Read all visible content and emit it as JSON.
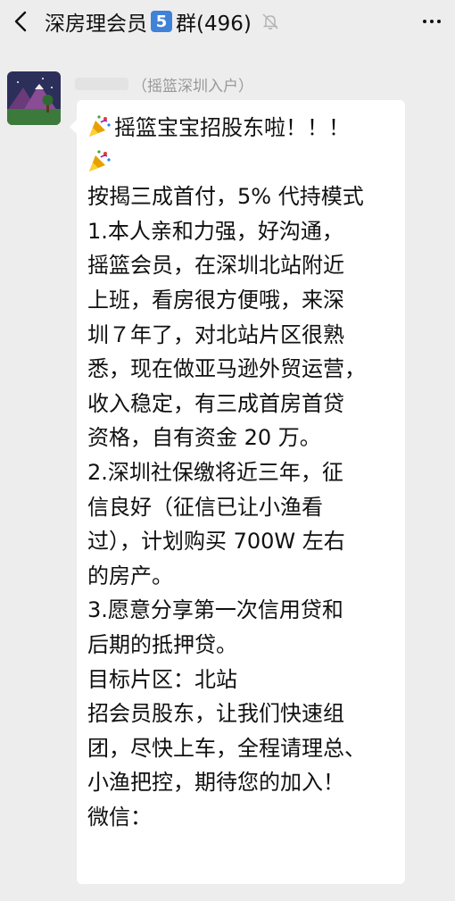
{
  "header": {
    "title": "深房理会员",
    "group_number": "5",
    "group_suffix": "群(496)"
  },
  "message": {
    "sender_tag": "（摇篮深圳入户）",
    "lines": [
      "摇篮宝宝招股东啦！！！",
      "",
      "按揭三成首付，5% 代持模式",
      "1.本人亲和力强，好沟通，",
      "摇篮会员，在深圳北站附近",
      "上班，看房很方便哦，来深",
      "圳７年了，对北站片区很熟",
      "悉，现在做亚马逊外贸运营，",
      "收入稳定，有三成首房首贷",
      "资格，自有资金 20 万。",
      "2.深圳社保缴将近三年，征",
      "信良好（征信已让小渔看",
      "过），计划购买 700W 左右",
      "的房产。",
      "3.愿意分享第一次信用贷和",
      "后期的抵押贷。",
      "目标片区：北站",
      "招会员股东，让我们快速组",
      "团，尽快上车，全程请理总、",
      "小渔把控，期待您的加入！",
      "微信："
    ]
  }
}
